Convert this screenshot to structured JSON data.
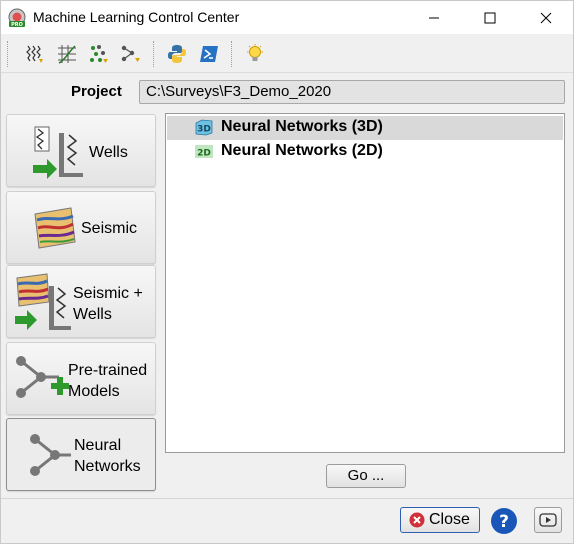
{
  "window": {
    "title": "Machine Learning Control Center"
  },
  "toolbar": {
    "icons": [
      "well-logs-icon",
      "crossplot-icon",
      "scatter-points-icon",
      "network-export-icon",
      "python-icon",
      "powershell-icon",
      "lightbulb-icon"
    ]
  },
  "project": {
    "label": "Project",
    "path": "C:\\Surveys\\F3_Demo_2020"
  },
  "sidebar": {
    "items": [
      {
        "label": "Wells",
        "icon": "wells-icon"
      },
      {
        "label": "Seismic",
        "icon": "seismic-icon"
      },
      {
        "label": "Seismic +\nWells",
        "icon": "seismic-wells-icon"
      },
      {
        "label": "Pre-trained\nModels",
        "icon": "pretrained-models-icon"
      },
      {
        "label": "Neural\nNetworks",
        "icon": "neural-networks-icon",
        "selected": true
      }
    ]
  },
  "list": {
    "items": [
      {
        "label": "Neural Networks (3D)",
        "icon": "3d-icon",
        "selected": true
      },
      {
        "label": "Neural Networks (2D)",
        "icon": "2d-icon",
        "selected": false
      }
    ]
  },
  "buttons": {
    "go": "Go ...",
    "close": "Close"
  },
  "colors": {
    "close_accent": "#d0303a",
    "help_accent": "#1a56b8",
    "selection": "#d9d9d9"
  }
}
